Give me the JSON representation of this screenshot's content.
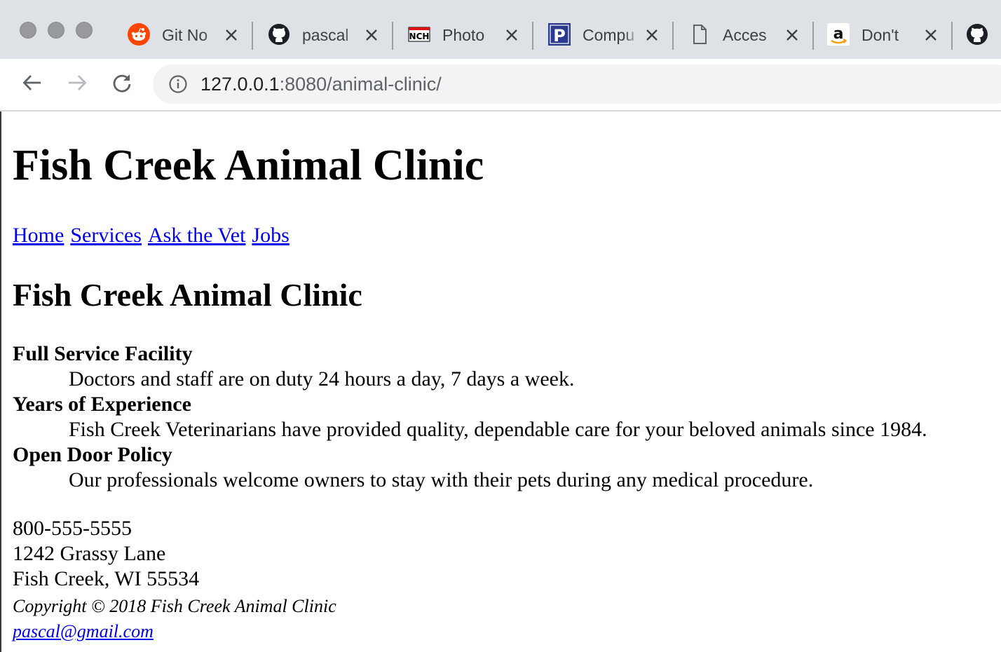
{
  "browser": {
    "tabs": [
      {
        "title": "Git No",
        "icon": "reddit-icon"
      },
      {
        "title": "pascal",
        "icon": "github-icon"
      },
      {
        "title": "Photo",
        "icon": "nch-icon"
      },
      {
        "title": "Compu",
        "icon": "p-icon"
      },
      {
        "title": "Acces",
        "icon": "document-icon"
      },
      {
        "title": "Don't",
        "icon": "amazon-icon"
      },
      {
        "title": "",
        "icon": "github-icon"
      }
    ],
    "nav": {
      "back_icon": "back-arrow-icon",
      "forward_icon": "forward-arrow-icon",
      "reload_icon": "reload-icon"
    },
    "address": {
      "host": "127.0.0.1",
      "rest": ":8080/animal-clinic/",
      "icon": "info-icon"
    }
  },
  "page": {
    "title": "Fish Creek Animal Clinic",
    "nav": [
      "Home",
      "Services",
      "Ask the Vet",
      "Jobs"
    ],
    "subtitle": "Fish Creek Animal Clinic",
    "features": [
      {
        "term": "Full Service Facility",
        "desc": "Doctors and staff are on duty 24 hours a day, 7 days a week."
      },
      {
        "term": "Years of Experience",
        "desc": "Fish Creek Veterinarians have provided quality, dependable care for your beloved animals since 1984."
      },
      {
        "term": "Open Door Policy",
        "desc": "Our professionals welcome owners to stay with their pets during any medical procedure."
      }
    ],
    "contact": {
      "phone": "800-555-5555",
      "street": "1242 Grassy Lane",
      "city": "Fish Creek, WI 55534"
    },
    "footer": {
      "copyright": "Copyright © 2018 Fish Creek Animal Clinic",
      "email": "pascal@gmail.com"
    }
  },
  "colors": {
    "link": "#0000ee",
    "tabstrip": "#dee1e6",
    "omnibox": "#f1f3f4",
    "reddit": "#ff4500",
    "p_icon": "#2b3a8c"
  }
}
